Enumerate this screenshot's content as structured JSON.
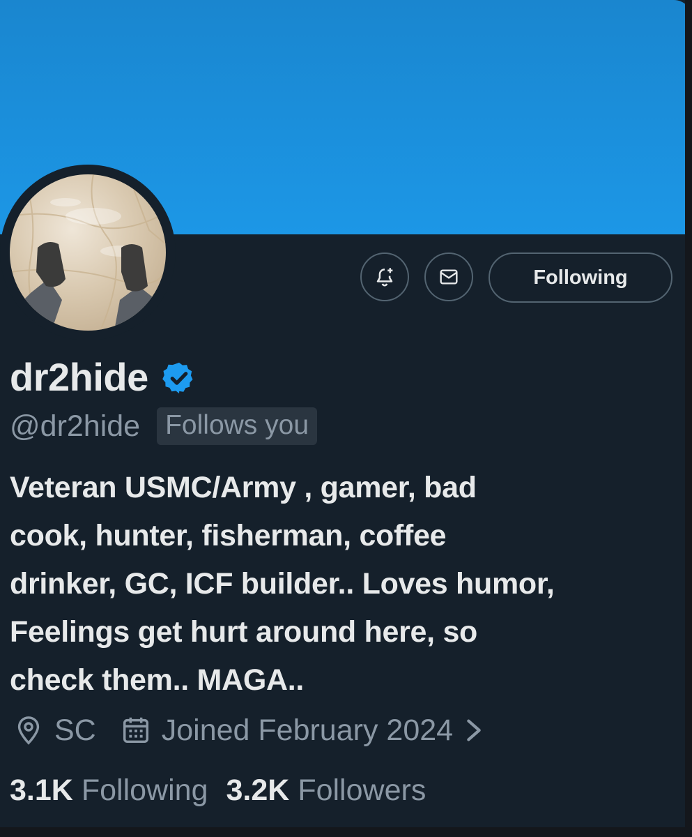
{
  "profile": {
    "name": "dr2hide",
    "handle": "@dr2hide",
    "follows_you": "Follows you",
    "bio_lines": [
      "Veteran USMC/Army , gamer, bad",
      "cook, hunter, fisherman, coffee",
      "drinker, GC, ICF builder.. Loves humor,",
      "Feelings get hurt around here, so",
      "check them.. MAGA.."
    ],
    "location": "SC",
    "joined": "Joined February 2024"
  },
  "actions": {
    "notify_icon": "bell-plus-icon",
    "message_icon": "mail-icon",
    "following_label": "Following"
  },
  "stats": {
    "following_count": "3.1K",
    "following_label": "Following",
    "followers_count": "3.2K",
    "followers_label": "Followers"
  },
  "colors": {
    "banner": "#1c97e6",
    "background": "#15202b",
    "text_primary": "#e7e9ea",
    "text_secondary": "#8b98a5",
    "verified": "#1d9bf0"
  }
}
